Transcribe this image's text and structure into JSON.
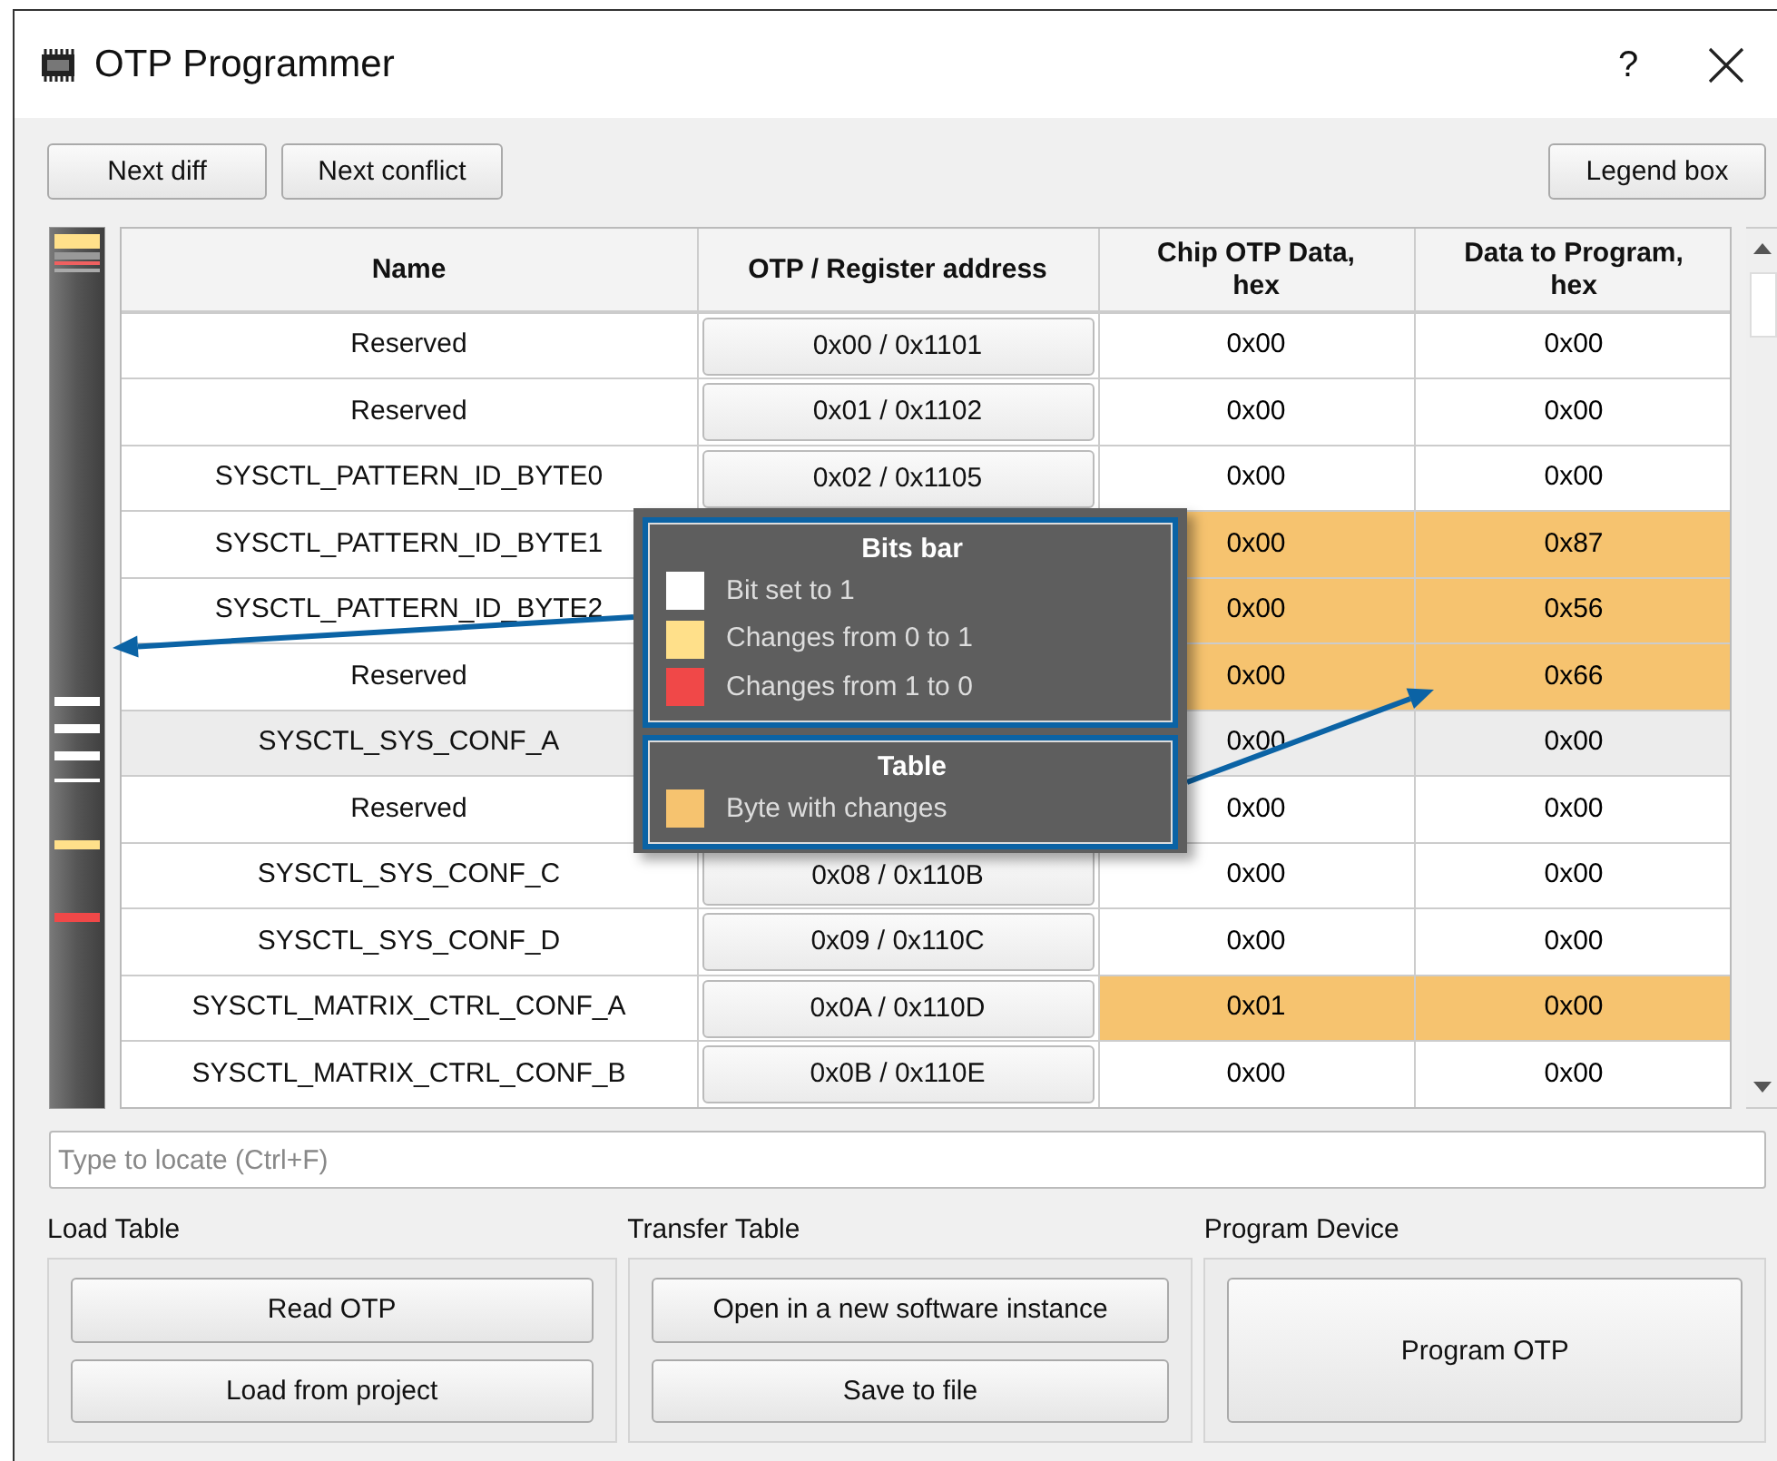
{
  "window": {
    "title": "OTP Programmer",
    "help": "?"
  },
  "toolbar": {
    "left_buttons": [
      "Next diff",
      "Next conflict"
    ],
    "right_button": "Legend box"
  },
  "table": {
    "columns": [
      "Name",
      "OTP / Register address",
      "Chip OTP Data, hex",
      "Data to Program, hex"
    ],
    "rows": [
      {
        "name": "Reserved",
        "address": "0x00 / 0x1101",
        "chip": "0x00",
        "program": "0x00",
        "changed": false,
        "selected": false
      },
      {
        "name": "Reserved",
        "address": "0x01 / 0x1102",
        "chip": "0x00",
        "program": "0x00",
        "changed": false,
        "selected": false
      },
      {
        "name": "SYSCTL_PATTERN_ID_BYTE0",
        "address": "0x02 / 0x1105",
        "chip": "0x00",
        "program": "0x00",
        "changed": false,
        "selected": false
      },
      {
        "name": "SYSCTL_PATTERN_ID_BYTE1",
        "chip": "0x00",
        "program": "0x87",
        "changed": true,
        "selected": false
      },
      {
        "name": "SYSCTL_PATTERN_ID_BYTE2",
        "chip": "0x00",
        "program": "0x56",
        "changed": true,
        "selected": false
      },
      {
        "name": "Reserved",
        "chip": "0x00",
        "program": "0x66",
        "changed": true,
        "selected": false
      },
      {
        "name": "SYSCTL_SYS_CONF_A",
        "chip": "0x00",
        "program": "0x00",
        "changed": false,
        "selected": true
      },
      {
        "name": "Reserved",
        "chip": "0x00",
        "program": "0x00",
        "changed": false,
        "selected": false
      },
      {
        "name": "SYSCTL_SYS_CONF_C",
        "address": "0x08 / 0x110B",
        "chip": "0x00",
        "program": "0x00",
        "changed": false,
        "selected": false
      },
      {
        "name": "SYSCTL_SYS_CONF_D",
        "address": "0x09 / 0x110C",
        "chip": "0x00",
        "program": "0x00",
        "changed": false,
        "selected": false
      },
      {
        "name": "SYSCTL_MATRIX_CTRL_CONF_A",
        "address": "0x0A / 0x110D",
        "chip": "0x01",
        "program": "0x00",
        "changed": true,
        "selected": false
      },
      {
        "name": "SYSCTL_MATRIX_CTRL_CONF_B",
        "address": "0x0B / 0x110E",
        "chip": "0x00",
        "program": "0x00",
        "changed": false,
        "selected": false
      }
    ]
  },
  "legend": {
    "sections": [
      {
        "title": "Bits bar",
        "items": [
          {
            "label": "Bit set to 1",
            "color": "#ffffff"
          },
          {
            "label": "Changes from 0 to 1",
            "color": "#ffe08a"
          },
          {
            "label": "Changes from 1 to 0",
            "color": "#f04848"
          }
        ]
      },
      {
        "title": "Table",
        "items": [
          {
            "label": "Byte with changes",
            "color": "#f6c36f"
          }
        ]
      }
    ]
  },
  "search": {
    "placeholder": "Type to locate (Ctrl+F)"
  },
  "groups": [
    {
      "title": "Load Table",
      "buttons": [
        "Read OTP",
        "Load from project"
      ]
    },
    {
      "title": "Transfer Table",
      "buttons": [
        "Open in a new software instance",
        "Save to file"
      ]
    },
    {
      "title": "Program Device",
      "buttons": [
        "Program OTP"
      ]
    }
  ]
}
